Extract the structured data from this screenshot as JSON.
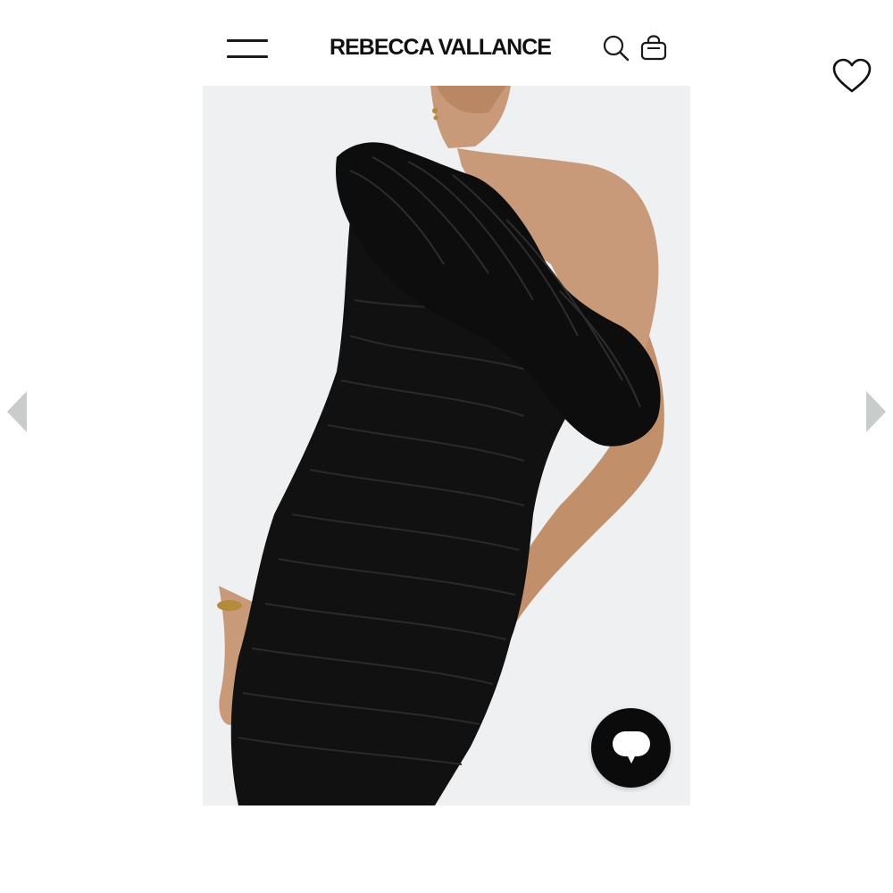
{
  "header": {
    "menu_icon": "hamburger-menu-icon",
    "brand_name": "REBECCA VALLANCE",
    "search_icon": "search-icon",
    "bag_icon": "shopping-bag-icon",
    "wishlist_icon": "heart-icon"
  },
  "gallery": {
    "image_description_icon": "product-photo",
    "prev_icon": "triangle-left-icon",
    "next_icon": "triangle-right-icon",
    "arrow_color": "#c8ccca",
    "background_color": "#eef0f2"
  },
  "chat": {
    "icon": "chat-bubble-icon",
    "button_color": "#0b0b0b"
  },
  "colors": {
    "dress": "#111111",
    "skin": "#c99a79"
  }
}
